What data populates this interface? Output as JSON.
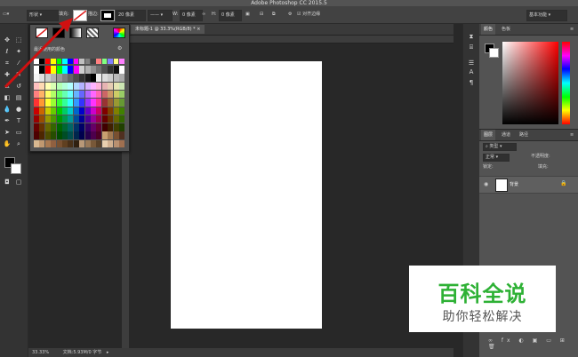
{
  "app": {
    "title": "Adobe Photoshop CC 2015.5"
  },
  "options_bar": {
    "mode": "形状",
    "fill_label": "填充:",
    "stroke_label": "描边:",
    "stroke_width": "20 像素",
    "w_label": "W:",
    "w_value": "0 像素",
    "h_label": "H:",
    "h_value": "0 像素",
    "align_edges": "对齐边缘",
    "workspace": "基本功能"
  },
  "document": {
    "tab": "未标题-1 @ 33.3%(RGB/8) *",
    "zoom": "33.33%",
    "doc_info": "文档:5.93M/0 字节"
  },
  "swatch_popup": {
    "recent_label": "最近使用的颜色",
    "grid": [
      [
        "#ffffff",
        "#000000",
        "#ff0000",
        "#ffff00",
        "#00ff00",
        "#00ffff",
        "#0000ff",
        "#ff00ff",
        "#d0d0d0",
        "#b0b0b0",
        "#909090",
        "#707070",
        "#505050",
        "#303030",
        "#101010",
        "#ffffff"
      ],
      [
        "#f5f5f5",
        "#e0e0e0",
        "#cccccc",
        "#b3b3b3",
        "#999999",
        "#808080",
        "#666666",
        "#4d4d4d",
        "#333333",
        "#1a1a1a",
        "#000000",
        "#eeeeee",
        "#dddddd",
        "#cccccc",
        "#bbbbbb",
        "#aaaaaa"
      ],
      [
        "#ffc0c0",
        "#ffd9b3",
        "#ffffb3",
        "#d9ffb3",
        "#b3ffb3",
        "#b3ffd9",
        "#b3ffff",
        "#b3d9ff",
        "#b3b3ff",
        "#d9b3ff",
        "#ffb3ff",
        "#ffb3d9",
        "#e6b3b3",
        "#e6ccb3",
        "#e6e6b3",
        "#cce6b3"
      ],
      [
        "#ff8080",
        "#ffb366",
        "#ffff66",
        "#b3ff66",
        "#66ff66",
        "#66ffb3",
        "#66ffff",
        "#66b3ff",
        "#6666ff",
        "#b366ff",
        "#ff66ff",
        "#ff66b3",
        "#cc6666",
        "#cc9966",
        "#cccc66",
        "#99cc66"
      ],
      [
        "#ff3333",
        "#ff9933",
        "#ffff33",
        "#99ff33",
        "#33ff33",
        "#33ff99",
        "#33ffff",
        "#3399ff",
        "#3333ff",
        "#9933ff",
        "#ff33ff",
        "#ff3399",
        "#993333",
        "#996633",
        "#999933",
        "#669933"
      ],
      [
        "#cc0000",
        "#cc6600",
        "#cccc00",
        "#66cc00",
        "#00cc00",
        "#00cc66",
        "#00cccc",
        "#0066cc",
        "#0000cc",
        "#6600cc",
        "#cc00cc",
        "#cc0066",
        "#800000",
        "#804000",
        "#808000",
        "#408000"
      ],
      [
        "#990000",
        "#994c00",
        "#999900",
        "#4c9900",
        "#009900",
        "#00994c",
        "#009999",
        "#004c99",
        "#000099",
        "#4c0099",
        "#990099",
        "#99004c",
        "#660000",
        "#663300",
        "#666600",
        "#336600"
      ],
      [
        "#660000",
        "#663300",
        "#666600",
        "#336600",
        "#006600",
        "#006633",
        "#006666",
        "#003366",
        "#000066",
        "#330066",
        "#660066",
        "#660033",
        "#400000",
        "#402000",
        "#404000",
        "#204000"
      ],
      [
        "#4d0000",
        "#4d2600",
        "#4d4d00",
        "#264d00",
        "#004d00",
        "#004d26",
        "#004d4d",
        "#00264d",
        "#00004d",
        "#26004d",
        "#4d004d",
        "#4d0026",
        "#c8a070",
        "#a07850",
        "#785030",
        "#503020"
      ],
      [
        "#d8b890",
        "#c09870",
        "#a87850",
        "#906040",
        "#785030",
        "#604020",
        "#483018",
        "#302010",
        "#b89878",
        "#987858",
        "#785838",
        "#584028",
        "#e8d0b0",
        "#d0b090",
        "#b89070",
        "#a07050"
      ]
    ],
    "recent": [
      "#ffffff",
      "#000000",
      "#ff0000",
      "#ffff00",
      "#00ff00",
      "#00ffff",
      "#0000ff",
      "#ff00ff",
      "#c0c0c0",
      "#808080",
      "#404040",
      "#ff8080",
      "#80ff80",
      "#8080ff",
      "#ffff80",
      "#ff80ff"
    ]
  },
  "color_panel": {
    "tabs": [
      "颜色",
      "色板"
    ]
  },
  "layers_panel": {
    "tabs": [
      "图层",
      "通道",
      "路径"
    ],
    "kind": "类型",
    "blend_mode": "正常",
    "opacity_label": "不透明度:",
    "lock_label": "锁定:",
    "fill_label": "填充:",
    "layer_name": "背景"
  },
  "watermark": {
    "line1": "百科全说",
    "line2": "助你轻松解决"
  },
  "colors": {
    "arrow": "#d01010",
    "accent_green": "#2eb135"
  }
}
